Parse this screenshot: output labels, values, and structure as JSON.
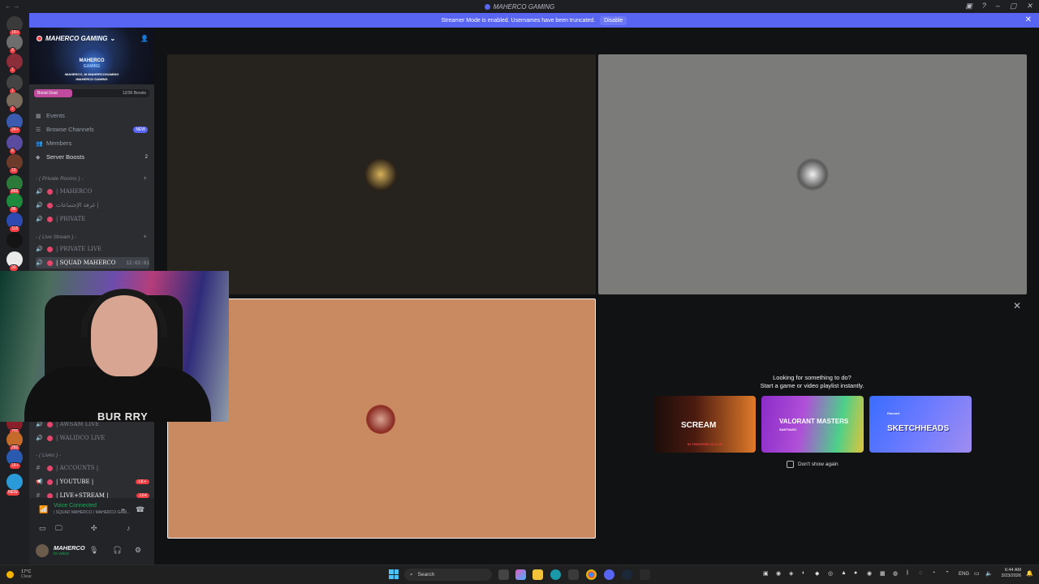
{
  "window": {
    "title": "MAHERCO GAMING",
    "controls": [
      "gift-icon",
      "help-icon",
      "minimize-icon",
      "maximize-icon",
      "close-icon"
    ]
  },
  "banner": {
    "message": "Streamer Mode is enabled. Usernames have been truncated.",
    "disable_label": "Disable",
    "color": "#5865f2"
  },
  "server_rail": {
    "servers": [
      {
        "badge": "1K+",
        "color": "#3a3a3a"
      },
      {
        "badge": "3",
        "color": "#6e6e6e"
      },
      {
        "badge": "1",
        "color": "#8b2e3a"
      },
      {
        "badge": "1",
        "color": "#444"
      },
      {
        "badge": "1",
        "color": "#7a6b5c"
      },
      {
        "badge": "2K+",
        "color": "#3b5bb0"
      },
      {
        "badge": "6",
        "color": "#5a4aa0"
      },
      {
        "badge": "15",
        "color": "#6c3b2a"
      },
      {
        "badge": "866",
        "color": "#2c7a3a"
      },
      {
        "badge": "96",
        "color": "#1d8a3d"
      },
      {
        "badge": "118",
        "color": "#2d4ab0"
      },
      {
        "badge": "",
        "color": "#141414"
      },
      {
        "badge": "30",
        "color": "#eaeaea"
      },
      {
        "badge": "792",
        "color": "#8a1f2a"
      },
      {
        "badge": "282",
        "color": "#c46a2a"
      },
      {
        "badge": "1K+",
        "color": "#2a5ab0"
      }
    ],
    "new_label": "NEW"
  },
  "server": {
    "name": "MAHERCO GAMING",
    "banner_title": "MAHERCO",
    "banner_subtitle": "GAMING",
    "banner_line1": "/MAHERCO_M /MAHERCOGAMING",
    "banner_line2": "/MAHERCO GAMING",
    "boost_goal_label": "Boost Goal",
    "boost_count": "12/36 Boosts",
    "boost_progress": 0.333
  },
  "nav": {
    "events": "Events",
    "browse": "Browse Channels",
    "browse_badge": "NEW",
    "members": "Members",
    "boosts": "Server Boosts",
    "boosts_count": "2"
  },
  "categories": {
    "private": "-  ( Private Rooms ) -",
    "live": "- ( Live Stream ) -",
    "lives": "- ( Lives ) -"
  },
  "channels": {
    "c1": "| MAHERCO",
    "c2": "غرفة الإجتماعات |",
    "c3": "| PRIVATE",
    "c4": "| PRIVATE LIVE",
    "c5": "| SQUAD MAHERCO",
    "c5_time": "12:02:01",
    "c6": "| AWSAM LIVE",
    "c7": "| WALIDCO LIVE",
    "c8": "| ACCOUNTS |",
    "c9": "| YOUTUBE |",
    "c9_badge": "1K+",
    "c10": "| LIVE+STREAM |",
    "c10_badge": "264"
  },
  "voice": {
    "status": "Voice Connected",
    "channel": "| SQUAD MAHERCO / MAHERCO GAM..."
  },
  "user": {
    "name": "MAHERCO",
    "status": "In voice"
  },
  "activity": {
    "line1": "Looking for something to do?",
    "line2": "Start a game or video playlist instantly.",
    "cards": [
      {
        "name": "SCREAM",
        "sub": "IN THEATERS 02.27.26"
      },
      {
        "name": "VALORANT MASTERS",
        "sub": "SANTIAGO"
      },
      {
        "name": "SKETCHHEADS",
        "sub": "Discord"
      }
    ],
    "dont_show": "Don't show again"
  },
  "webcam": {
    "shirt_text": "BUR  RRY"
  },
  "taskbar": {
    "weather_temp": "17°C",
    "weather_desc": "Clear",
    "search_placeholder": "Search",
    "language": "ENG",
    "time": "6:44 AM",
    "date": "3/23/2026"
  }
}
